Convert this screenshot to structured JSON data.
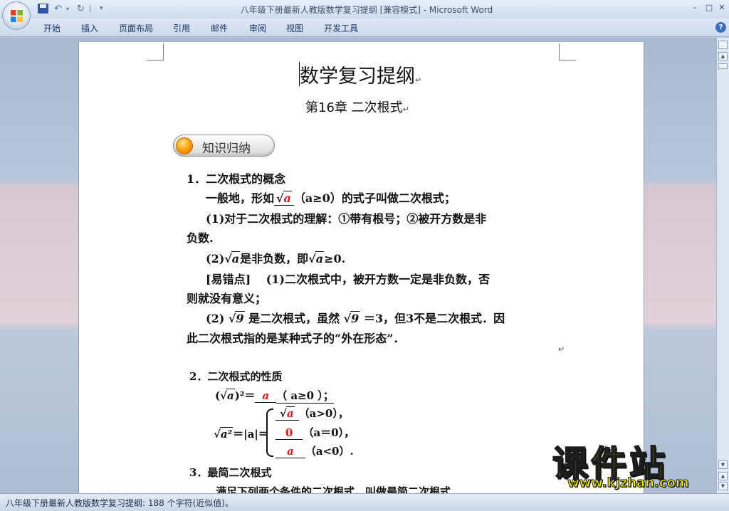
{
  "window": {
    "title": "八年级下册最新人教版数学复习提纲 [兼容模式] - Microsoft Word",
    "min_glyph": "–",
    "max_glyph": "□",
    "close_glyph": "✕"
  },
  "quick_access": {
    "undo_glyph": "↶",
    "redo_glyph": "↻",
    "drop_glyph": "▾",
    "sep_glyph": "|",
    "custom_glyph": "▾"
  },
  "ribbon": {
    "tabs": [
      "开始",
      "插入",
      "页面布局",
      "引用",
      "邮件",
      "审阅",
      "视图",
      "开发工具"
    ],
    "help_glyph": "?"
  },
  "document": {
    "title": "数学复习提纲",
    "subtitle": "第16章  二次根式",
    "para_mark": "↵",
    "knowledge_label": "知识归纳",
    "s1": {
      "heading": "1．二次根式的概念",
      "def_a": "一般地，形如",
      "def_rad": "a",
      "def_b": "（a≥0）的式子叫做二次根式；",
      "p1": "(1)对于二次根式的理解：①带有根号；②被开方数是非",
      "p1b": "负数.",
      "p2_a": "(2)",
      "p2_rad1": "a",
      "p2_b": "是非负数，即",
      "p2_rad2": "a",
      "p2_c": "≥0.",
      "p3": "[易错点]　 (1)二次根式中，被开方数一定是非负数，否",
      "p3b": "则就没有意义；",
      "p4_a": "(2) ",
      "p4_rad1": "9",
      "p4_b": " 是二次根式，虽然 ",
      "p4_rad2": "9",
      "p4_c": " ＝3，但3不是二次根式．因",
      "p4b": "此二次根式指的是某种式子的“外在形态”．"
    },
    "s2": {
      "heading": "2．二次根式的性质",
      "f1_a": "(",
      "f1_rad": "a",
      "f1_b": ")²＝",
      "f1_ans": "a",
      "f1_cond": "（   a≥0   ）；",
      "f2_lhs_rad": "a²",
      "f2_lhs_b": "＝|a|＝",
      "c1_ans": "a",
      "c1_cond": "（a>0），",
      "c2_ans": "0",
      "c2_cond": "（a＝0），",
      "c3_ans": "a",
      "c3_cond": "（a<0）."
    },
    "s3": {
      "heading": "3．最简二次根式",
      "p1": "满足下列两个条件的二次根式，叫做最简二次根式."
    }
  },
  "statusbar": {
    "text": "八年级下册最新人教版数学复习提纲: 188 个字符(近似值)。"
  },
  "watermark": {
    "big": "课件站",
    "url": "www.kjzhan.com"
  }
}
